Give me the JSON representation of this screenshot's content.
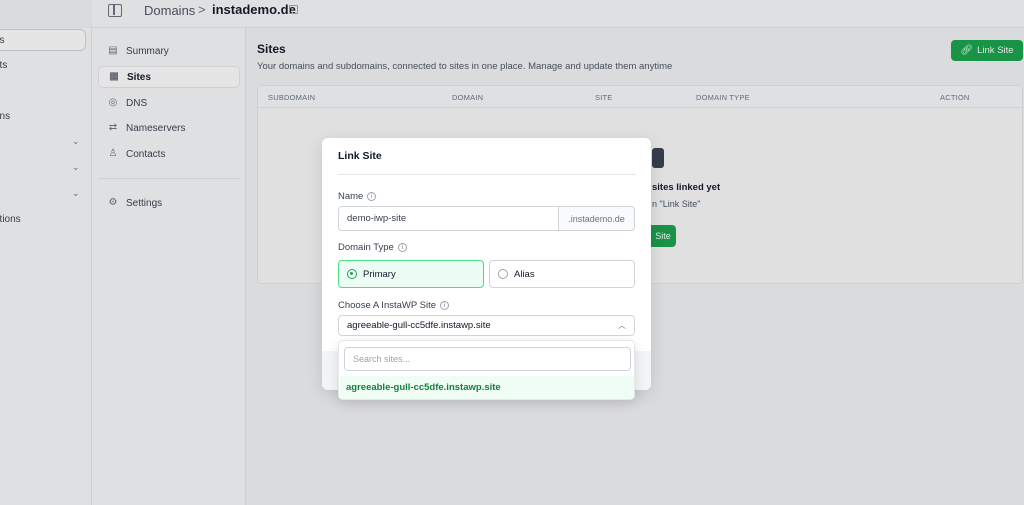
{
  "left_rail": {
    "items": [
      {
        "label": "ns",
        "active": true
      },
      {
        "label": "ots"
      },
      {
        "label": "e"
      },
      {
        "label": "ons"
      },
      {
        "label": ""
      },
      {
        "label": ""
      },
      {
        "label": "s"
      },
      {
        "label": "ations"
      }
    ]
  },
  "breadcrumb": {
    "root": "Domains",
    "separator": ">",
    "current": "instademo.de"
  },
  "subnav": {
    "items": [
      {
        "label": "Summary",
        "icon": "document-icon"
      },
      {
        "label": "Sites",
        "icon": "layout-icon",
        "active": true
      },
      {
        "label": "DNS",
        "icon": "globe-icon"
      },
      {
        "label": "Nameservers",
        "icon": "transfer-icon"
      },
      {
        "label": "Contacts",
        "icon": "user-icon"
      },
      {
        "label": "Settings",
        "icon": "gear-icon"
      }
    ]
  },
  "main": {
    "title": "Sites",
    "description": "Your domains and subdomains, connected to sites in one place. Manage and update them anytime",
    "link_site_button": "Link Site",
    "table": {
      "columns": [
        "SUBDOMAIN",
        "DOMAIN",
        "SITE",
        "DOMAIN TYPE",
        "ACTION"
      ],
      "empty_title": "sites linked yet",
      "empty_sub": "n \"Link Site\"",
      "empty_button": "Site"
    }
  },
  "modal": {
    "title": "Link Site",
    "name_label": "Name",
    "name_value": "demo-iwp-site",
    "name_suffix": ".instademo.de",
    "domain_type_label": "Domain Type",
    "domain_type_options": [
      {
        "label": "Primary",
        "selected": true
      },
      {
        "label": "Alias",
        "selected": false
      }
    ],
    "site_label": "Choose A InstaWP Site",
    "site_value": "agreeable-gull-cc5dfe.instawp.site",
    "dropdown": {
      "search_placeholder": "Search sites...",
      "options": [
        "agreeable-gull-cc5dfe.instawp.site"
      ]
    }
  },
  "colors": {
    "accent": "#16a34a",
    "selected_bg": "#ecfdf5"
  }
}
